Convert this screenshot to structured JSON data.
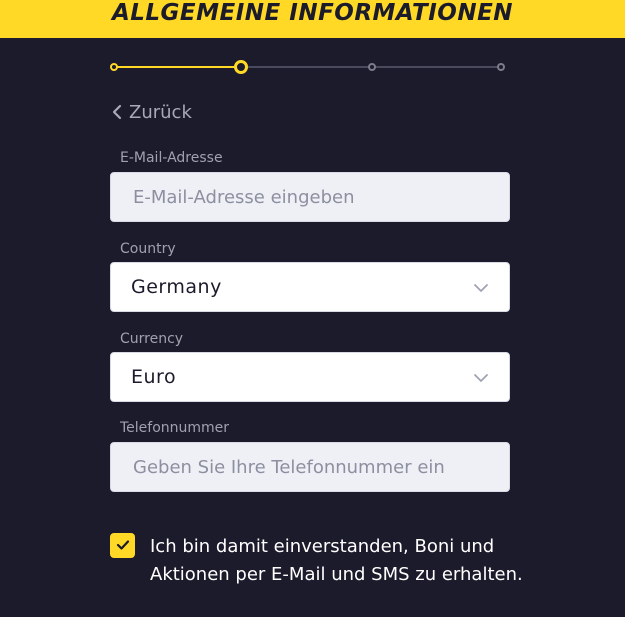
{
  "header": {
    "title": "ALLGEMEINE INFORMATIONEN"
  },
  "stepper": {
    "total_steps": 4,
    "current_step": 2
  },
  "back": {
    "label": "Zurück"
  },
  "email": {
    "label": "E-Mail-Adresse",
    "placeholder": "E-Mail-Adresse eingeben",
    "value": ""
  },
  "country": {
    "label": "Country",
    "value": "Germany"
  },
  "currency": {
    "label": "Currency",
    "value": "Euro"
  },
  "phone": {
    "label": "Telefonnummer",
    "placeholder": "Geben Sie Ihre Telefonnummer ein",
    "value": ""
  },
  "consent": {
    "checked": true,
    "text": "Ich bin damit einverstanden, Boni und Aktionen per E-Mail und SMS zu erhalten."
  },
  "icons": {
    "back": "chevron-left-icon",
    "select": "chevron-down-icon",
    "check": "check-icon"
  },
  "colors": {
    "accent": "#ffd926",
    "background": "#1c1b2b",
    "track_inactive": "#4a4a5c"
  }
}
